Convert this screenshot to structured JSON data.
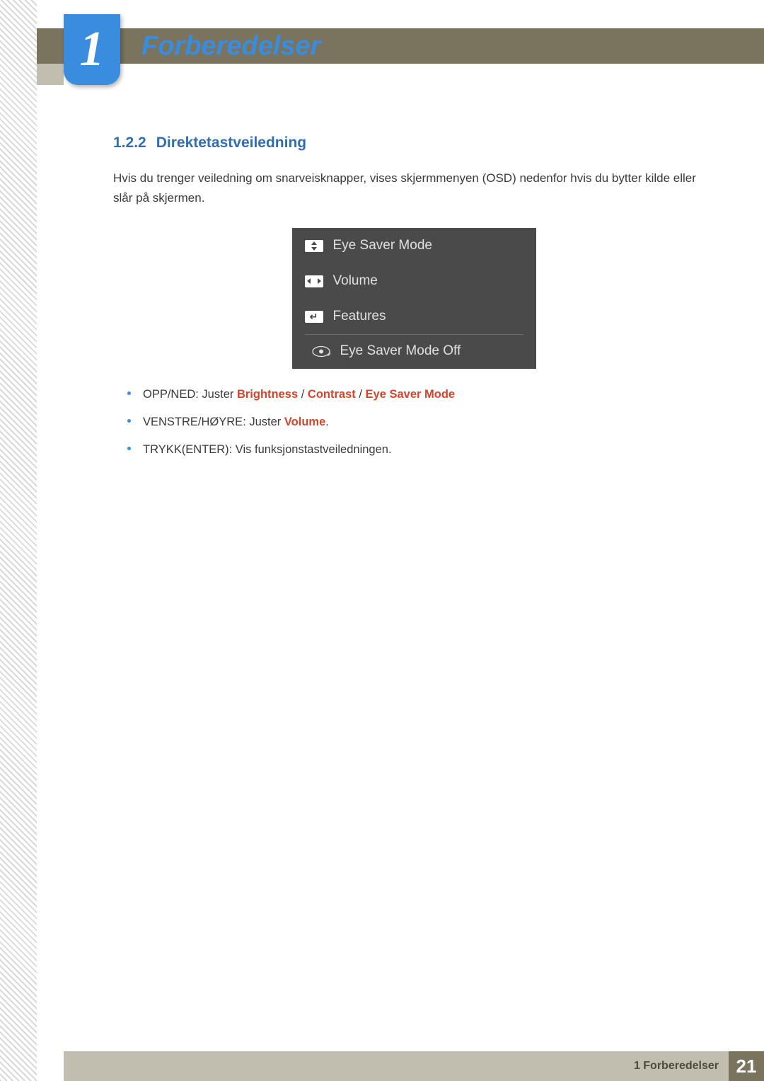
{
  "chapter": {
    "number": "1",
    "title": "Forberedelser"
  },
  "section": {
    "number": "1.2.2",
    "title": "Direktetastveiledning"
  },
  "intro": "Hvis du trenger veiledning om snarveisknapper, vises skjermmenyen (OSD) nedenfor hvis du bytter kilde eller slår på skjermen.",
  "osd": {
    "items": [
      {
        "icon": "updown",
        "label": "Eye Saver Mode"
      },
      {
        "icon": "leftright",
        "label": "Volume"
      },
      {
        "icon": "enter",
        "label": "Features"
      }
    ],
    "status": "Eye Saver Mode Off"
  },
  "bullets": {
    "b1_prefix": "OPP/NED: Juster ",
    "b1_h1": "Brightness",
    "b1_sep1": " / ",
    "b1_h2": "Contrast",
    "b1_sep2": " / ",
    "b1_h3": "Eye Saver Mode",
    "b2_prefix": "VENSTRE/HØYRE: Juster ",
    "b2_h1": "Volume",
    "b2_suffix": ".",
    "b3": "TRYKK(ENTER): Vis funksjonstastveiledningen."
  },
  "footer": {
    "label": "1 Forberedelser",
    "page": "21"
  }
}
